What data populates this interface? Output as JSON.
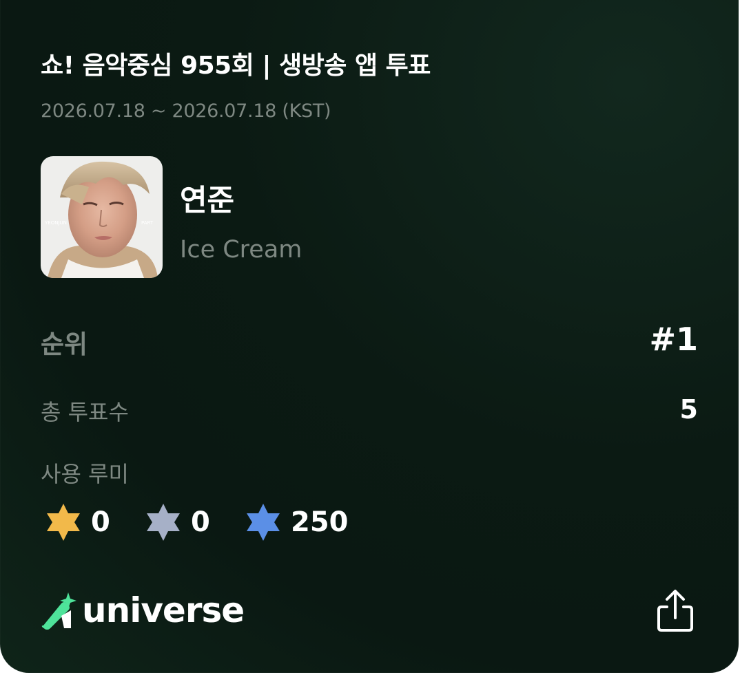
{
  "card": {
    "title": "쇼! 음악중심 955회 | 생방송 앱 투표",
    "date_range": "2026.07.18 ~ 2026.07.18 (KST)"
  },
  "entry": {
    "artist": "연준",
    "song": "Ice Cream",
    "cover_icon": "album-cover-image"
  },
  "stats": {
    "rank_label": "순위",
    "rank_value": "#1",
    "total_votes_label": "총 투표수",
    "total_votes_value": "5",
    "rumi_label": "사용 루미"
  },
  "rumi": [
    {
      "icon": "gold-star-icon",
      "color": "#f2b94a",
      "amount": "0"
    },
    {
      "icon": "silver-star-icon",
      "color": "#a6b0c7",
      "amount": "0"
    },
    {
      "icon": "blue-star-icon",
      "color": "#5b8fe6",
      "amount": "250"
    }
  ],
  "footer": {
    "brand": "universe",
    "brand_accent_color": "#4ee39a",
    "share_icon": "share-icon"
  }
}
